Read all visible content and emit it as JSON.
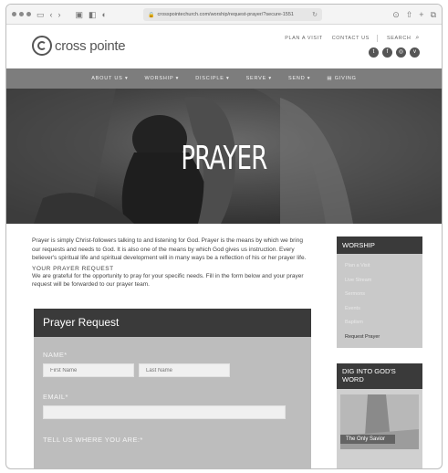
{
  "browser": {
    "url": "crosspointechurch.com/worship/request-prayer/?secure-1551"
  },
  "header": {
    "logo_text": "cross pointe",
    "links": [
      "PLAN A VISIT",
      "CONTACT US",
      "SEARCH"
    ]
  },
  "nav": {
    "items": [
      "ABOUT US ▾",
      "WORSHIP ▾",
      "DISCIPLE ▾",
      "SERVE ▾",
      "SEND ▾",
      "GIVING"
    ]
  },
  "hero": {
    "title": "PRAYER"
  },
  "main": {
    "intro": "Prayer is simply Christ-followers talking to and listening for God. Prayer is the means by which we bring our requests and needs to God. It is also one of the means by which God gives us instruction. Every believer's spiritual life and spiritual development will in many ways be a reflection of his or her prayer life.",
    "request_heading": "YOUR PRAYER REQUEST",
    "request_text": "We are grateful for the opportunity to pray for your specific needs. Fill in the form below and your prayer request will be forwarded to our prayer team."
  },
  "form": {
    "title": "Prayer Request",
    "name_label": "NAME*",
    "first_name_placeholder": "First Name",
    "last_name_placeholder": "Last Name",
    "email_label": "EMAIL*",
    "location_label": "TELL US WHERE YOU ARE:*"
  },
  "sidebar": {
    "worship_title": "WORSHIP",
    "items": [
      "Plan a Visit",
      "Live Stream",
      "Sermons",
      "Events",
      "Baptism",
      "Request Prayer"
    ],
    "dig_title": "DIG INTO GOD'S WORD",
    "dig_image_label": "The Only Savior"
  }
}
